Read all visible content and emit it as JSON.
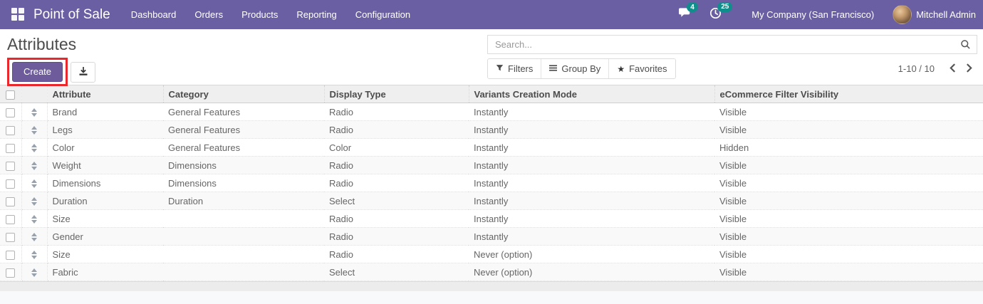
{
  "nav": {
    "app_name": "Point of Sale",
    "menu_items": [
      "Dashboard",
      "Orders",
      "Products",
      "Reporting",
      "Configuration"
    ],
    "messages_badge": "4",
    "activities_badge": "25",
    "company": "My Company (San Francisco)",
    "user": "Mitchell Admin"
  },
  "control_panel": {
    "title": "Attributes",
    "create_label": "Create",
    "search_placeholder": "Search...",
    "filters_label": "Filters",
    "group_by_label": "Group By",
    "favorites_label": "Favorites",
    "pager_range": "1-10 / 10"
  },
  "table": {
    "columns": [
      "Attribute",
      "Category",
      "Display Type",
      "Variants Creation Mode",
      "eCommerce Filter Visibility"
    ],
    "rows": [
      {
        "attribute": "Brand",
        "category": "General Features",
        "display_type": "Radio",
        "variants_mode": "Instantly",
        "visibility": "Visible"
      },
      {
        "attribute": "Legs",
        "category": "General Features",
        "display_type": "Radio",
        "variants_mode": "Instantly",
        "visibility": "Visible"
      },
      {
        "attribute": "Color",
        "category": "General Features",
        "display_type": "Color",
        "variants_mode": "Instantly",
        "visibility": "Hidden"
      },
      {
        "attribute": "Weight",
        "category": "Dimensions",
        "display_type": "Radio",
        "variants_mode": "Instantly",
        "visibility": "Visible"
      },
      {
        "attribute": "Dimensions",
        "category": "Dimensions",
        "display_type": "Radio",
        "variants_mode": "Instantly",
        "visibility": "Visible"
      },
      {
        "attribute": "Duration",
        "category": "Duration",
        "display_type": "Select",
        "variants_mode": "Instantly",
        "visibility": "Visible"
      },
      {
        "attribute": "Size",
        "category": "",
        "display_type": "Radio",
        "variants_mode": "Instantly",
        "visibility": "Visible"
      },
      {
        "attribute": "Gender",
        "category": "",
        "display_type": "Radio",
        "variants_mode": "Instantly",
        "visibility": "Visible"
      },
      {
        "attribute": "Size",
        "category": "",
        "display_type": "Radio",
        "variants_mode": "Never (option)",
        "visibility": "Visible"
      },
      {
        "attribute": "Fabric",
        "category": "",
        "display_type": "Select",
        "variants_mode": "Never (option)",
        "visibility": "Visible"
      }
    ]
  },
  "icons": {
    "apps": "grid-of-squares",
    "messages": "chat-bubble",
    "activities": "clock",
    "search": "magnifier",
    "filters": "funnel",
    "group_by": "horizontal-bars",
    "favorites": "star",
    "export": "download-tray",
    "pager_prev": "chevron-left",
    "pager_next": "chevron-right",
    "row_handle": "up-down-triangles",
    "row_select": "checkbox"
  },
  "colors": {
    "navbar": "#6b5fa3",
    "primary": "#6d5b9c",
    "badge": "#0f8e8c",
    "annotation": "#e8282c"
  }
}
